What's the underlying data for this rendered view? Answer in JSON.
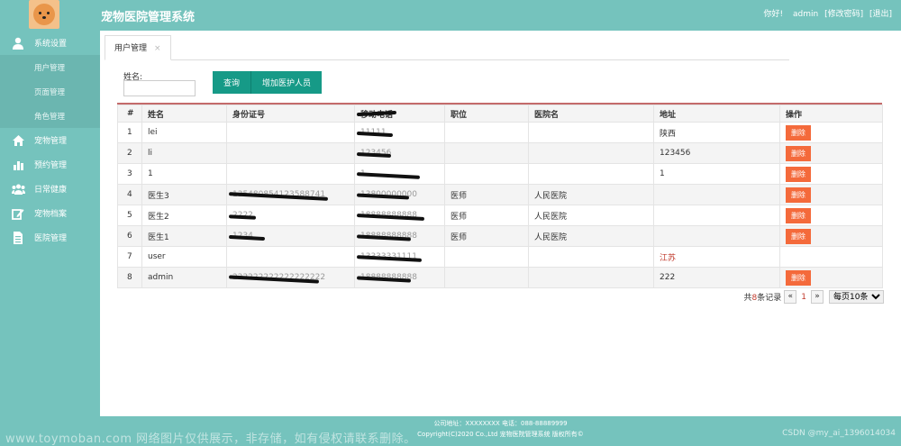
{
  "header": {
    "title": "宠物医院管理系统",
    "greeting": "你好!",
    "username": "admin",
    "change_password": "[修改密码]",
    "logout": "[退出]"
  },
  "sidebar": {
    "items": [
      {
        "label": "系统设置",
        "icon": "user-icon"
      },
      {
        "label": "用户管理",
        "sub": true
      },
      {
        "label": "页面管理",
        "sub": true
      },
      {
        "label": "角色管理",
        "sub": true
      },
      {
        "label": "宠物管理",
        "icon": "home-icon"
      },
      {
        "label": "预约管理",
        "icon": "bar-chart-icon"
      },
      {
        "label": "日常健康",
        "icon": "group-icon"
      },
      {
        "label": "宠物档案",
        "icon": "edit-icon"
      },
      {
        "label": "医院管理",
        "icon": "document-icon"
      }
    ]
  },
  "tab": {
    "label": "用户管理",
    "close": "×"
  },
  "search": {
    "label": "姓名:",
    "value": "",
    "query_button": "查询",
    "add_button": "增加医护人员"
  },
  "table": {
    "headers": [
      "#",
      "姓名",
      "身份证号",
      "移动电话",
      "职位",
      "医院名",
      "地址",
      "操作"
    ],
    "rows": [
      {
        "num": "1",
        "name": "lei",
        "id_card": "",
        "phone": "11111",
        "position": "",
        "hospital": "",
        "address": "陕西",
        "action": "删除"
      },
      {
        "num": "2",
        "name": "li",
        "id_card": "",
        "phone": "123456",
        "position": "",
        "hospital": "",
        "address": "123456",
        "action": "删除"
      },
      {
        "num": "3",
        "name": "1",
        "id_card": "",
        "phone": "1",
        "position": "",
        "hospital": "",
        "address": "1",
        "action": "删除"
      },
      {
        "num": "4",
        "name": "医生3",
        "id_card": "135480854123588741",
        "phone": "13800000000",
        "position": "医师",
        "hospital": "人民医院",
        "address": "",
        "action": "删除"
      },
      {
        "num": "5",
        "name": "医生2",
        "id_card": "2222",
        "phone": "18888888888",
        "position": "医师",
        "hospital": "人民医院",
        "address": "",
        "action": "删除"
      },
      {
        "num": "6",
        "name": "医生1",
        "id_card": "1234",
        "phone": "18888888888",
        "position": "医师",
        "hospital": "人民医院",
        "address": "",
        "action": "删除"
      },
      {
        "num": "7",
        "name": "user",
        "id_card": "",
        "phone": "13333331111",
        "position": "",
        "hospital": "",
        "address": "江苏",
        "action": ""
      },
      {
        "num": "8",
        "name": "admin",
        "id_card": "222222222222222222",
        "phone": "18888888888",
        "position": "",
        "hospital": "",
        "address": "222",
        "action": "删除"
      }
    ]
  },
  "pager": {
    "total_prefix": "共",
    "total": "8",
    "total_suffix": "条记录",
    "prev": "«",
    "current": "1",
    "next": "»",
    "per_page": "每页10条"
  },
  "footer": {
    "line1": "公司地址：XXXXXXXX 电话：088-88889999",
    "line2": "Copyright(C)2020 Co.,Ltd 宠物医院管理系统 版权所有©"
  },
  "watermark": {
    "left": "www.toymoban.com 网络图片仅供展示，非存储，如有侵权请联系删除。",
    "right": "CSDN @my_ai_1396014034"
  },
  "colors": {
    "theme": "#75c3bd",
    "button": "#169a87",
    "delete": "#f46a3b"
  }
}
